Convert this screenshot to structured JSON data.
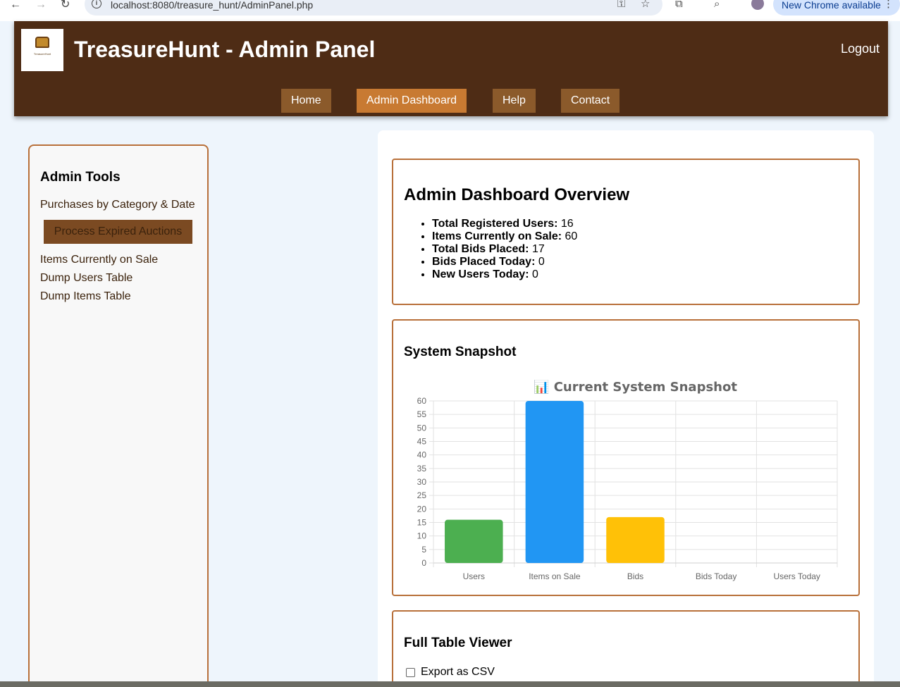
{
  "browser": {
    "url": "localhost:8080/treasure_hunt/AdminPanel.php",
    "update_label": "New Chrome available"
  },
  "header": {
    "logo_text": "TreasureHunt",
    "title": "TreasureHunt - Admin Panel",
    "logout": "Logout",
    "nav": [
      "Home",
      "Admin Dashboard",
      "Help",
      "Contact"
    ],
    "active_nav": "Admin Dashboard"
  },
  "sidebar": {
    "title": "Admin Tools",
    "links": {
      "purchases": "Purchases by Category & Date",
      "process_button": "Process Expired Auctions",
      "items_on_sale": "Items Currently on Sale",
      "dump_users": "Dump Users Table",
      "dump_items": "Dump Items Table"
    }
  },
  "overview": {
    "title": "Admin Dashboard Overview",
    "stats": [
      {
        "label": "Total Registered Users:",
        "value": "16"
      },
      {
        "label": "Items Currently on Sale:",
        "value": "60"
      },
      {
        "label": "Total Bids Placed:",
        "value": "17"
      },
      {
        "label": "Bids Placed Today:",
        "value": "0"
      },
      {
        "label": "New Users Today:",
        "value": "0"
      }
    ]
  },
  "snapshot": {
    "title": "System Snapshot"
  },
  "chart_data": {
    "type": "bar",
    "title": "📊 Current System Snapshot",
    "categories": [
      "Users",
      "Items on Sale",
      "Bids",
      "Bids Today",
      "Users Today"
    ],
    "values": [
      16,
      60,
      17,
      0,
      0
    ],
    "colors": [
      "#4caf50",
      "#2196f3",
      "#ffc107",
      "#f44336",
      "#9c27b0"
    ],
    "ylim": [
      0,
      60
    ],
    "yticks": [
      0,
      5,
      10,
      15,
      20,
      25,
      30,
      35,
      40,
      45,
      50,
      55,
      60
    ],
    "grid": true
  },
  "table_viewer": {
    "title": "Full Table Viewer",
    "csv_label": "Export as CSV"
  }
}
